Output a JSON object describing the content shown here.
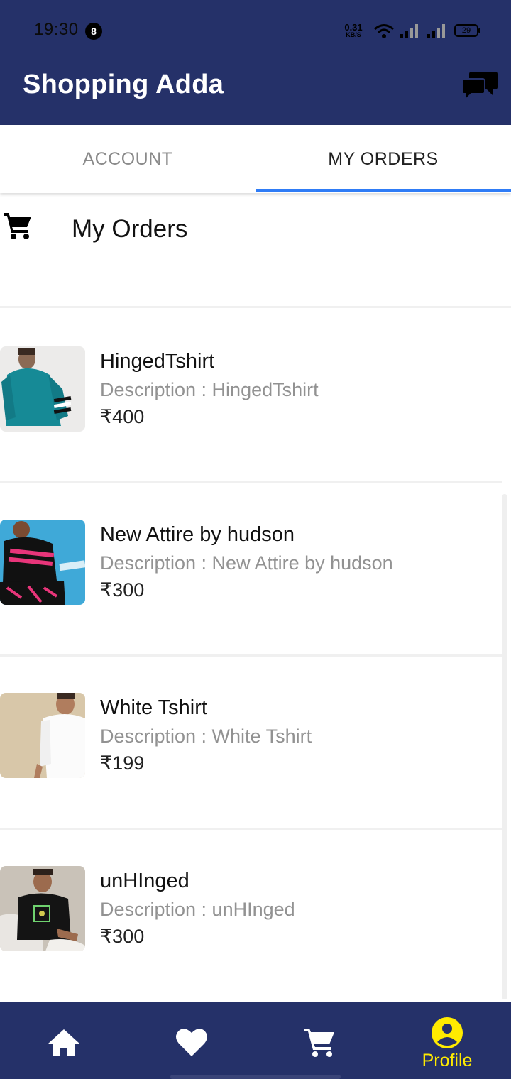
{
  "status_bar": {
    "time": "19:30",
    "notification_count": "8",
    "net_speed_value": "0.31",
    "net_speed_unit": "KB/S",
    "battery": "29"
  },
  "app_bar": {
    "title": "Shopping Adda",
    "chat_icon": "chat-bubbles-icon"
  },
  "tabs": [
    {
      "label": "ACCOUNT",
      "selected": false
    },
    {
      "label": "MY ORDERS",
      "selected": true
    }
  ],
  "orders_section": {
    "title": "My Orders",
    "icon": "cart-icon"
  },
  "orders": [
    {
      "name": "HingedTshirt",
      "description": "Description : HingedTshirt",
      "price": "₹400",
      "image": "teal-hoodie-photo"
    },
    {
      "name": "New Attire by hudson",
      "description": "Description : New Attire by hudson",
      "price": "₹300",
      "image": "black-pink-tshirt-photo"
    },
    {
      "name": "White Tshirt",
      "description": "Description : White Tshirt",
      "price": "₹199",
      "image": "white-tshirt-photo"
    },
    {
      "name": "unHInged",
      "description": "Description : unHInged",
      "price": "₹300",
      "image": "black-graphic-tshirt-photo"
    }
  ],
  "bottom_nav": [
    {
      "icon": "home-icon",
      "label": ""
    },
    {
      "icon": "heart-icon",
      "label": ""
    },
    {
      "icon": "cart-icon",
      "label": ""
    },
    {
      "icon": "profile-icon",
      "label": "Profile",
      "active": true
    }
  ],
  "colors": {
    "primary": "#253169",
    "tab_indicator": "#2f7cf6",
    "active_nav": "#ffeb00"
  }
}
